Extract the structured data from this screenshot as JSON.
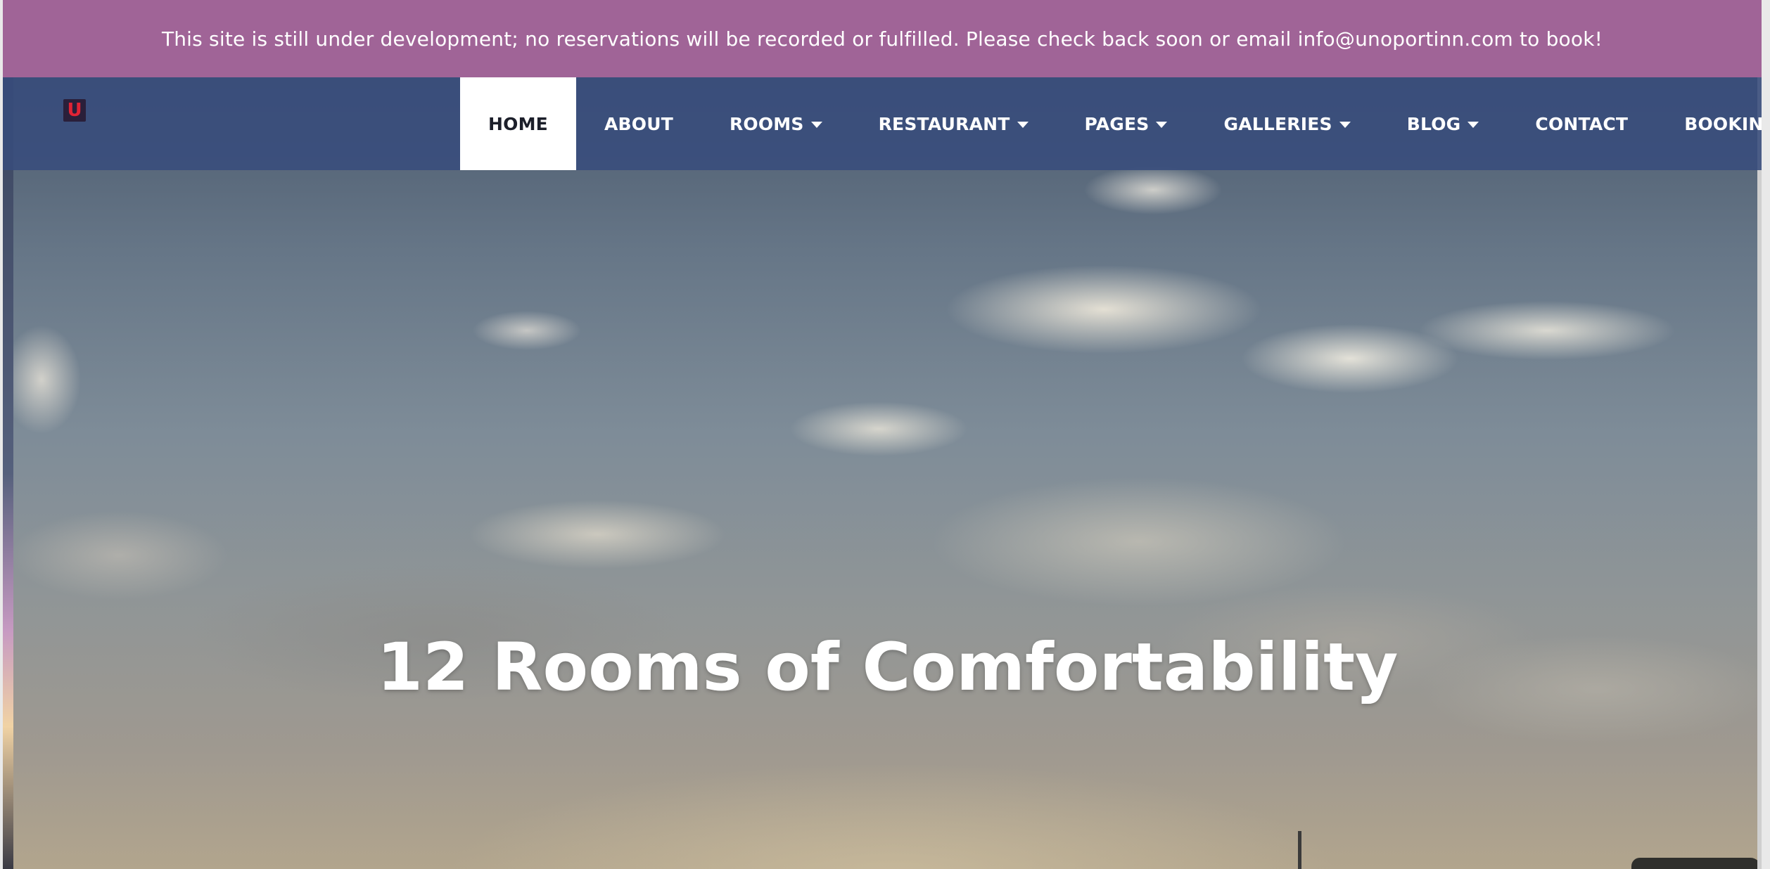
{
  "notice": {
    "text": "This site is still under development; no reservations will be recorded or fulfilled. Please check back soon or email info@unoportinn.com to book!"
  },
  "header": {
    "logo_letter": "U",
    "nav": [
      {
        "label": "HOME",
        "active": true,
        "has_dropdown": false
      },
      {
        "label": "ABOUT",
        "active": false,
        "has_dropdown": false
      },
      {
        "label": "ROOMS",
        "active": false,
        "has_dropdown": true
      },
      {
        "label": "RESTAURANT",
        "active": false,
        "has_dropdown": true
      },
      {
        "label": "PAGES",
        "active": false,
        "has_dropdown": true
      },
      {
        "label": "GALLERIES",
        "active": false,
        "has_dropdown": true
      },
      {
        "label": "BLOG",
        "active": false,
        "has_dropdown": true
      },
      {
        "label": "CONTACT",
        "active": false,
        "has_dropdown": false
      },
      {
        "label": "BOOKING",
        "active": false,
        "has_dropdown": false
      }
    ]
  },
  "hero": {
    "title": "12 Rooms of Comfortability"
  },
  "colors": {
    "notice_bg": "#a06497",
    "nav_bg": "#384c7c",
    "active_tab_bg": "#ffffff",
    "logo_accent": "#e02335"
  },
  "icons": {
    "dropdown": "caret-down-icon"
  }
}
